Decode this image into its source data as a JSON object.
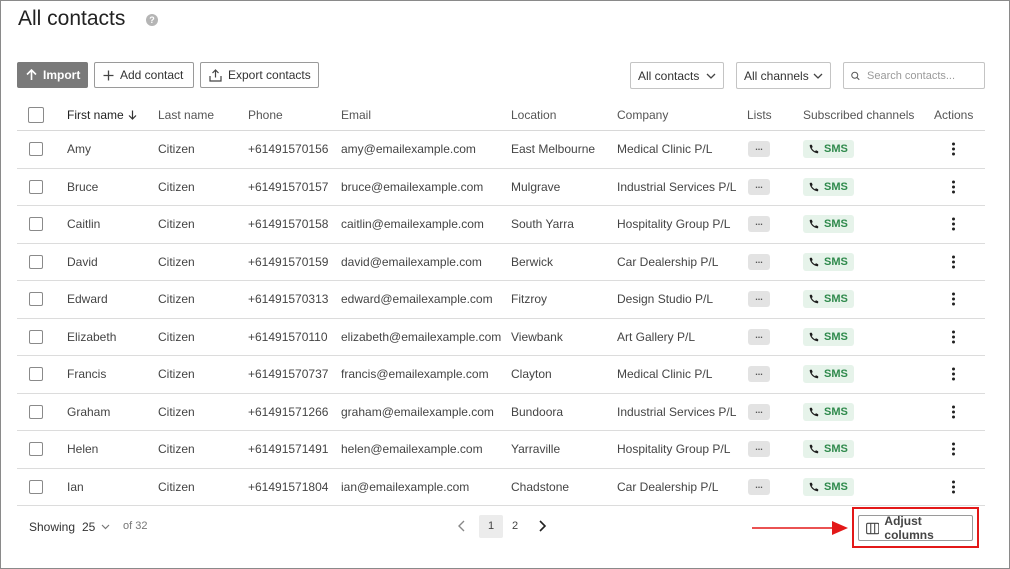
{
  "page": {
    "title": "All contacts",
    "help_icon": "help-circle-icon"
  },
  "toolbar": {
    "import_label": "Import",
    "add_contact_label": "Add contact",
    "export_label": "Export contacts",
    "filter_contacts": "All contacts",
    "filter_channels": "All channels",
    "search_placeholder": "Search contacts..."
  },
  "table": {
    "columns": [
      "First name",
      "Last name",
      "Phone",
      "Email",
      "Location",
      "Company",
      "Lists",
      "Subscribed channels",
      "Actions"
    ],
    "rows": [
      {
        "first": "Amy",
        "last": "Citizen",
        "phone": "+61491570156",
        "email": "amy@emailexample.com",
        "location": "East Melbourne",
        "company": "Medical Clinic P/L",
        "lists": "...",
        "channel": "SMS"
      },
      {
        "first": "Bruce",
        "last": "Citizen",
        "phone": "+61491570157",
        "email": "bruce@emailexample.com",
        "location": "Mulgrave",
        "company": "Industrial Services P/L",
        "lists": "...",
        "channel": "SMS"
      },
      {
        "first": "Caitlin",
        "last": "Citizen",
        "phone": "+61491570158",
        "email": "caitlin@emailexample.com",
        "location": "South Yarra",
        "company": "Hospitality Group P/L",
        "lists": "...",
        "channel": "SMS"
      },
      {
        "first": "David",
        "last": "Citizen",
        "phone": "+61491570159",
        "email": "david@emailexample.com",
        "location": "Berwick",
        "company": "Car Dealership P/L",
        "lists": "...",
        "channel": "SMS"
      },
      {
        "first": "Edward",
        "last": "Citizen",
        "phone": "+61491570313",
        "email": "edward@emailexample.com",
        "location": "Fitzroy",
        "company": "Design Studio P/L",
        "lists": "...",
        "channel": "SMS"
      },
      {
        "first": "Elizabeth",
        "last": "Citizen",
        "phone": "+61491570110",
        "email": "elizabeth@emailexample.com",
        "location": "Viewbank",
        "company": "Art Gallery P/L",
        "lists": "...",
        "channel": "SMS"
      },
      {
        "first": "Francis",
        "last": "Citizen",
        "phone": "+61491570737",
        "email": "francis@emailexample.com",
        "location": "Clayton",
        "company": "Medical Clinic P/L",
        "lists": "...",
        "channel": "SMS"
      },
      {
        "first": "Graham",
        "last": "Citizen",
        "phone": "+61491571266",
        "email": "graham@emailexample.com",
        "location": "Bundoora",
        "company": "Industrial Services P/L",
        "lists": "...",
        "channel": "SMS"
      },
      {
        "first": "Helen",
        "last": "Citizen",
        "phone": "+61491571491",
        "email": "helen@emailexample.com",
        "location": "Yarraville",
        "company": "Hospitality Group P/L",
        "lists": "...",
        "channel": "SMS"
      },
      {
        "first": "Ian",
        "last": "Citizen",
        "phone": "+61491571804",
        "email": "ian@emailexample.com",
        "location": "Chadstone",
        "company": "Car Dealership P/L",
        "lists": "...",
        "channel": "SMS"
      }
    ]
  },
  "footer": {
    "showing_label": "Showing",
    "per_page": "25",
    "of_total": "of 32",
    "pages": [
      "1",
      "2"
    ],
    "current_page": "1",
    "adjust_columns_label": "Adjust columns"
  },
  "colors": {
    "highlight": "#e31818",
    "sms_green": "#2f8a4c",
    "primary_button": "#7a7a7a"
  }
}
